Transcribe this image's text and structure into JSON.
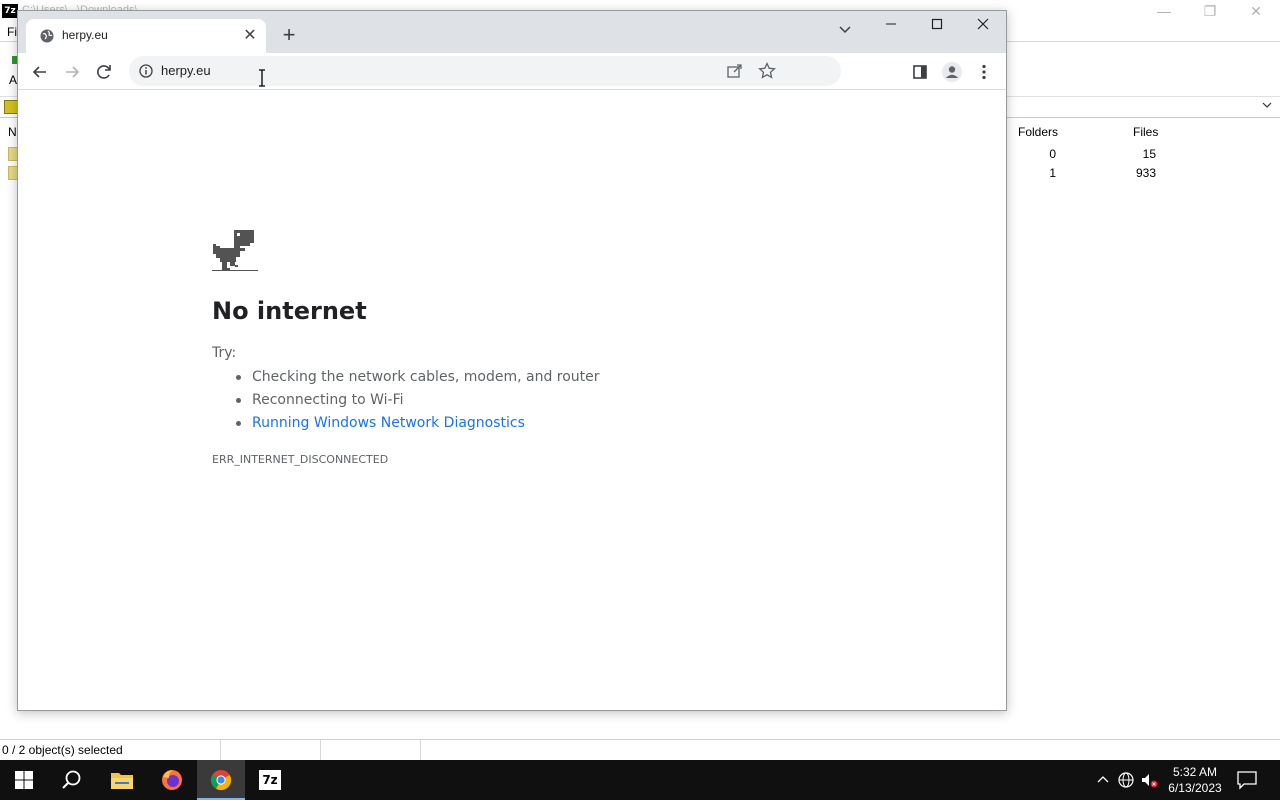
{
  "background_app": {
    "title_text": "C:\\Users\\...\\Downloads\\...",
    "icon_label": "7z",
    "menu_first_letter": "Fi",
    "toolbar_first_letter": "A",
    "address_first_letter": "",
    "columns": {
      "name": "N",
      "folders": "Folders",
      "files": "Files"
    },
    "rows": [
      {
        "folders": "0",
        "files": "15"
      },
      {
        "folders": "1",
        "files": "933"
      }
    ],
    "status": "0 / 2 object(s) selected"
  },
  "chrome": {
    "tab": {
      "title": "herpy.eu",
      "close_label": "✕"
    },
    "new_tab_label": "+",
    "url": "herpy.eu",
    "error": {
      "heading": "No internet",
      "try_label": "Try:",
      "suggestions": [
        "Checking the network cables, modem, and router",
        "Reconnecting to Wi-Fi",
        "Running Windows Network Diagnostics"
      ],
      "code": "ERR_INTERNET_DISCONNECTED"
    }
  },
  "taskbar": {
    "clock_time": "5:32 AM",
    "clock_date": "6/13/2023",
    "sevenzip_label": "7z"
  },
  "colors": {
    "link": "#1a73e8",
    "tabstrip": "#dee1e6",
    "taskbar": "#101010"
  }
}
